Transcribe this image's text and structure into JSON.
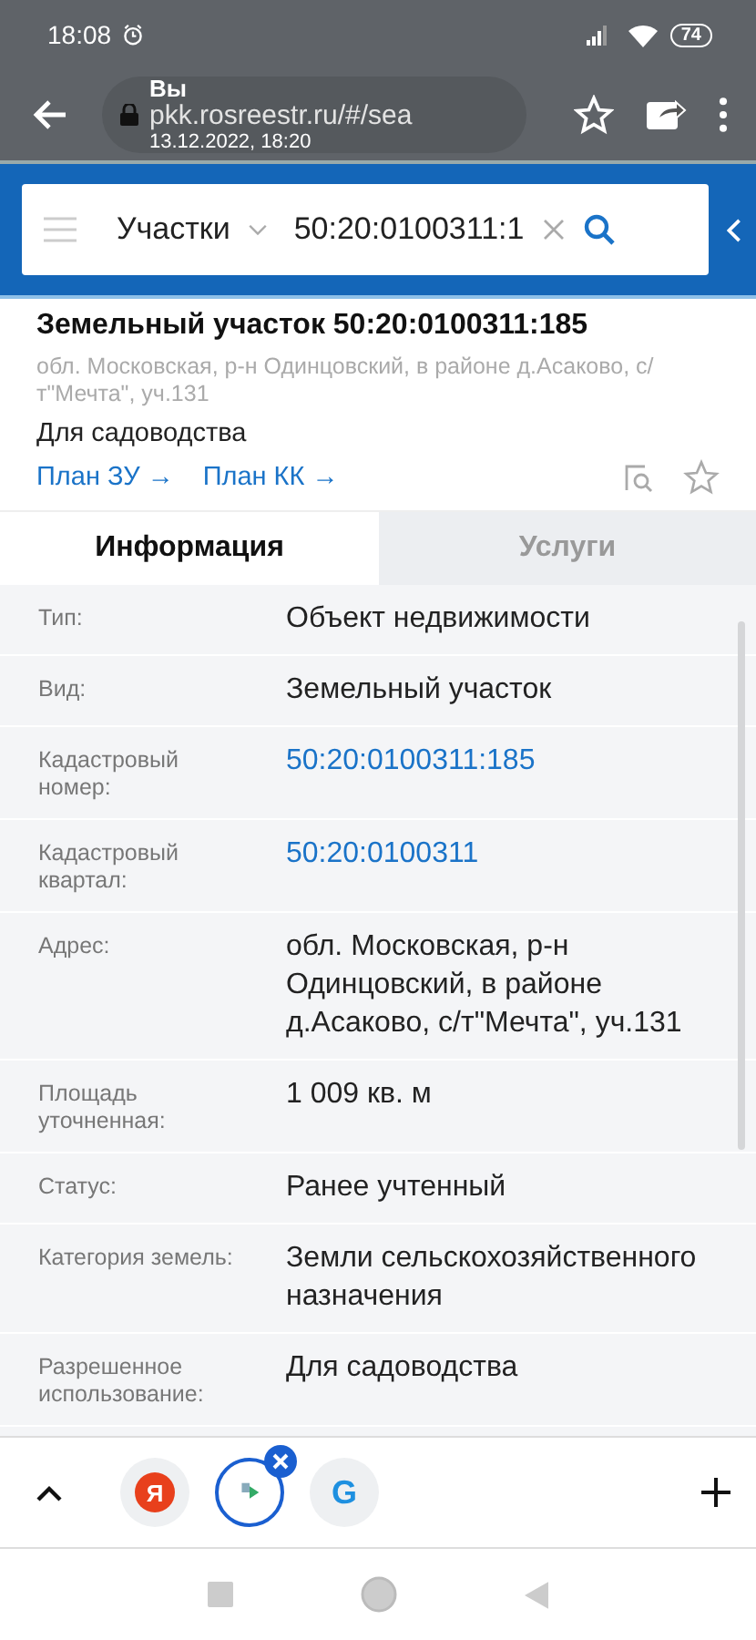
{
  "status_bar": {
    "time": "18:08",
    "battery": "74"
  },
  "browser": {
    "url": "pkk.rosreestr.ru/#/sea",
    "overlay_title": "Вы",
    "overlay_date": "13.12.2022, 18:20"
  },
  "search": {
    "category": "Участки",
    "value": "50:20:0100311:1"
  },
  "card": {
    "title": "Земельный участок 50:20:0100311:185",
    "address": "обл. Московская, р-н Одинцовский, в районе д.Асаково, с/т\"Мечта\", уч.131",
    "purpose": "Для садоводства",
    "links": [
      "План ЗУ →",
      "План КК →"
    ]
  },
  "tabs": [
    {
      "label": "Информация",
      "selected": true
    },
    {
      "label": "Услуги",
      "selected": false
    }
  ],
  "rows": [
    {
      "label": "Тип:",
      "value": "Объект недвижимости",
      "kind": "text"
    },
    {
      "label": "Вид:",
      "value": "Земельный участок",
      "kind": "text"
    },
    {
      "label": "Кадастровый номер:",
      "value": "50:20:0100311:185",
      "kind": "link"
    },
    {
      "label": "Кадастровый квартал:",
      "value": "50:20:0100311",
      "kind": "link"
    },
    {
      "label": "Адрес:",
      "value": "обл. Московская, р-н Одинцовский, в районе д.Асаково, с/т\"Мечта\", уч.131",
      "kind": "text"
    },
    {
      "label": "Площадь уточненная:",
      "value": "1 009 кв. м",
      "kind": "text"
    },
    {
      "label": "Статус:",
      "value": "Ранее учтенный",
      "kind": "text"
    },
    {
      "label": "Категория земель:",
      "value": "Земли сельскохозяйственного назначения",
      "kind": "text"
    },
    {
      "label": "Разрешенное использование:",
      "value": "Для садоводства",
      "kind": "text"
    }
  ],
  "bottom_tabs": [
    {
      "glyph": "Я",
      "selected": false
    },
    {
      "selected": true
    },
    {
      "glyph": "G",
      "selected": false
    }
  ]
}
